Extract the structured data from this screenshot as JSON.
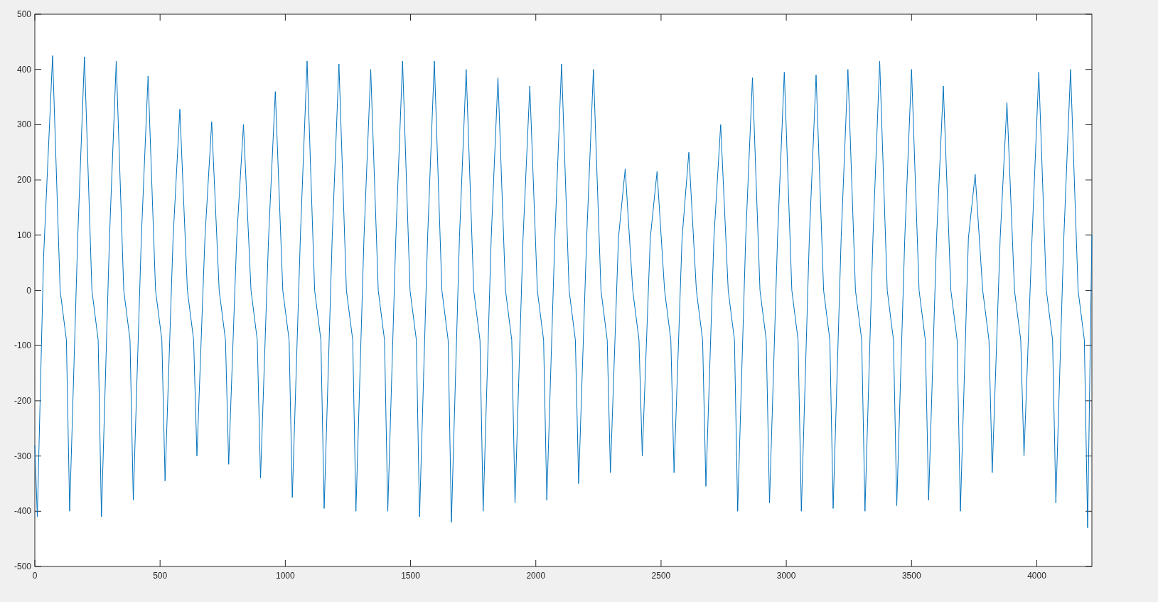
{
  "figure": {
    "chart_data": {
      "type": "line",
      "xlim": [
        0,
        4220
      ],
      "ylim": [
        -500,
        500
      ],
      "xticks": [
        0,
        500,
        1000,
        1500,
        2000,
        2500,
        3000,
        3500,
        4000
      ],
      "yticks": [
        -500,
        -400,
        -300,
        -200,
        -100,
        0,
        100,
        200,
        300,
        400,
        500
      ],
      "x": [
        0,
        10,
        35,
        71,
        101,
        126,
        139,
        171,
        198,
        228,
        253,
        266,
        298,
        325,
        355,
        380,
        393,
        425,
        452,
        482,
        507,
        520,
        552,
        579,
        609,
        634,
        647,
        679,
        706,
        736,
        761,
        774,
        806,
        833,
        863,
        888,
        901,
        933,
        960,
        990,
        1015,
        1028,
        1060,
        1087,
        1117,
        1142,
        1155,
        1187,
        1214,
        1244,
        1269,
        1282,
        1314,
        1341,
        1371,
        1396,
        1409,
        1441,
        1468,
        1498,
        1523,
        1536,
        1568,
        1595,
        1625,
        1650,
        1663,
        1695,
        1722,
        1752,
        1777,
        1790,
        1822,
        1849,
        1879,
        1904,
        1917,
        1949,
        1976,
        2006,
        2031,
        2044,
        2076,
        2103,
        2133,
        2158,
        2171,
        2203,
        2230,
        2260,
        2285,
        2298,
        2330,
        2357,
        2387,
        2412,
        2425,
        2457,
        2484,
        2514,
        2539,
        2552,
        2584,
        2611,
        2641,
        2666,
        2679,
        2711,
        2738,
        2768,
        2793,
        2806,
        2838,
        2865,
        2895,
        2920,
        2933,
        2965,
        2992,
        3022,
        3047,
        3060,
        3092,
        3119,
        3149,
        3174,
        3187,
        3219,
        3246,
        3276,
        3301,
        3314,
        3346,
        3373,
        3403,
        3428,
        3441,
        3473,
        3500,
        3530,
        3555,
        3568,
        3600,
        3627,
        3657,
        3682,
        3695,
        3727,
        3754,
        3784,
        3809,
        3822,
        3854,
        3881,
        3911,
        3936,
        3949,
        3981,
        4008,
        4038,
        4063,
        4076,
        4108,
        4135,
        4165,
        4190,
        4203,
        4220
      ],
      "series": [
        {
          "color": "#0072bd",
          "values": [
            -280,
            -410,
            60,
            425,
            0,
            -90,
            -400,
            95,
            423,
            0,
            -90,
            -410,
            95,
            415,
            0,
            -90,
            -380,
            95,
            388,
            0,
            -90,
            -345,
            95,
            328,
            0,
            -90,
            -300,
            95,
            305,
            0,
            -90,
            -315,
            95,
            300,
            0,
            -90,
            -340,
            95,
            360,
            0,
            -90,
            -375,
            95,
            415,
            0,
            -90,
            -395,
            95,
            410,
            0,
            -90,
            -400,
            95,
            400,
            0,
            -90,
            -400,
            95,
            415,
            0,
            -90,
            -410,
            95,
            415,
            0,
            -90,
            -420,
            95,
            400,
            0,
            -90,
            -400,
            95,
            385,
            0,
            -90,
            -385,
            95,
            370,
            0,
            -90,
            -380,
            95,
            410,
            0,
            -90,
            -350,
            95,
            400,
            0,
            -90,
            -330,
            95,
            220,
            0,
            -90,
            -300,
            95,
            215,
            0,
            -90,
            -330,
            95,
            250,
            0,
            -90,
            -355,
            95,
            300,
            0,
            -90,
            -400,
            95,
            385,
            0,
            -90,
            -385,
            95,
            395,
            0,
            -90,
            -400,
            95,
            390,
            0,
            -90,
            -395,
            95,
            400,
            0,
            -90,
            -400,
            95,
            415,
            0,
            -90,
            -390,
            95,
            400,
            0,
            -90,
            -380,
            95,
            370,
            0,
            -90,
            -400,
            95,
            210,
            0,
            -90,
            -330,
            95,
            340,
            0,
            -90,
            -300,
            95,
            395,
            0,
            -90,
            -385,
            95,
            400,
            0,
            -90,
            -430,
            100
          ]
        }
      ]
    }
  }
}
